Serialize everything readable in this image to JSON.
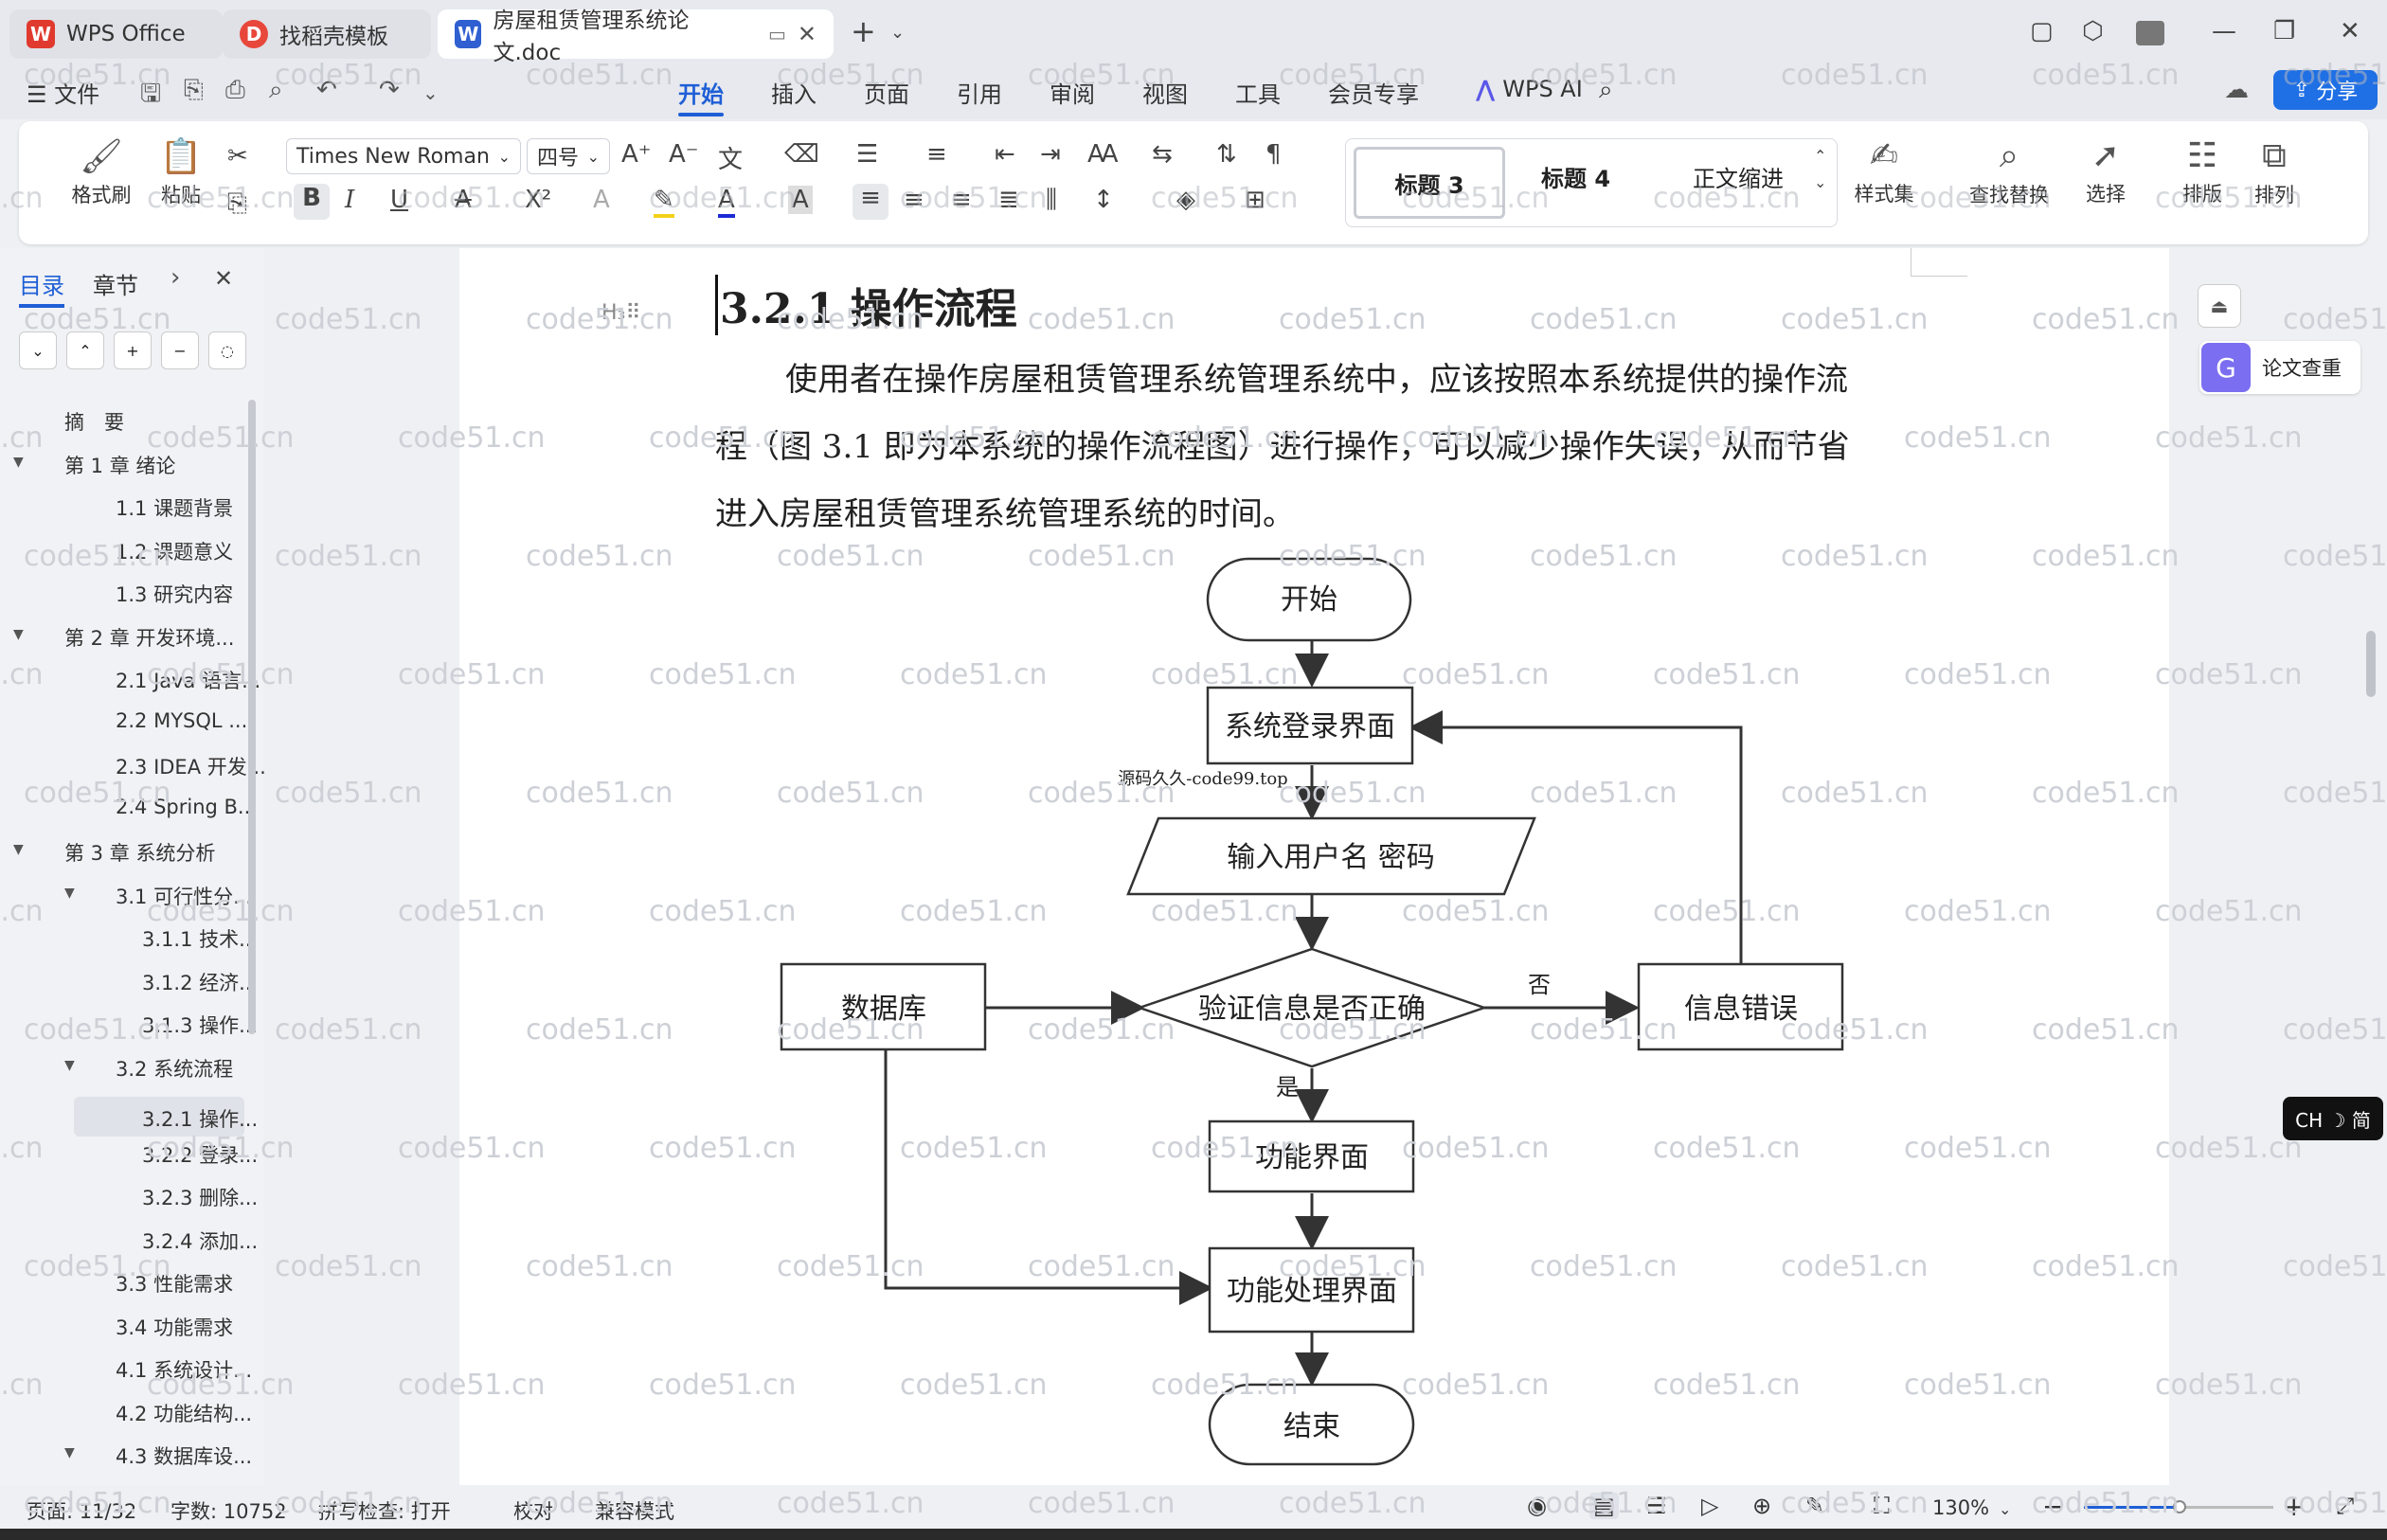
{
  "tabs": [
    {
      "label": "WPS Office"
    },
    {
      "label": "找稻壳模板"
    },
    {
      "label": "房屋租赁管理系统论文.doc"
    }
  ],
  "menu": {
    "file": "文件",
    "items": [
      "开始",
      "插入",
      "页面",
      "引用",
      "审阅",
      "视图",
      "工具",
      "会员专享"
    ],
    "active": "开始",
    "wps_ai": "WPS AI",
    "share": "分享"
  },
  "ribbon": {
    "format_painter": "格式刷",
    "paste": "粘贴",
    "font": "Times New Roman",
    "size": "四号",
    "styles": [
      "标题 3",
      "标题 4",
      "正文缩进"
    ],
    "style_set": "样式集",
    "find_replace": "查找替换",
    "select": "选择",
    "typeset": "排版",
    "arrange": "排列"
  },
  "nav": {
    "tab_toc": "目录",
    "tab_chapter": "章节",
    "items": [
      {
        "label": "摘　要",
        "level": 0
      },
      {
        "label": "第 1 章  绪论",
        "level": 0,
        "toggle": true
      },
      {
        "label": "1.1  课题背景",
        "level": 1
      },
      {
        "label": "1.2  课题意义",
        "level": 1
      },
      {
        "label": "1.3  研究内容",
        "level": 1
      },
      {
        "label": "第 2 章  开发环境...",
        "level": 0,
        "toggle": true
      },
      {
        "label": "2.1 Java 语言...",
        "level": 1
      },
      {
        "label": "2.2 MYSQL ...",
        "level": 1
      },
      {
        "label": "2.3 IDEA 开发...",
        "level": 1
      },
      {
        "label": "2.4 Spring B...",
        "level": 1
      },
      {
        "label": "第 3 章  系统分析",
        "level": 0,
        "toggle": true
      },
      {
        "label": "3.1  可行性分...",
        "level": 1,
        "toggle": true
      },
      {
        "label": "3.1.1  技术...",
        "level": 2
      },
      {
        "label": "3.1.2  经济...",
        "level": 2
      },
      {
        "label": "3.1.3  操作...",
        "level": 2
      },
      {
        "label": "3.2  系统流程",
        "level": 1,
        "toggle": true
      },
      {
        "label": "3.2.1  操作...",
        "level": 2,
        "active": true
      },
      {
        "label": "3.2.2  登录...",
        "level": 2
      },
      {
        "label": "3.2.3  删除...",
        "level": 2
      },
      {
        "label": "3.2.4  添加...",
        "level": 2
      },
      {
        "label": "3.3  性能需求",
        "level": 1
      },
      {
        "label": "3.4  功能需求",
        "level": 1
      },
      {
        "label": "4.1  系统设计...",
        "level": 1
      },
      {
        "label": "4.2  功能结构...",
        "level": 1
      },
      {
        "label": "4.3  数据库设...",
        "level": 1,
        "toggle": true
      }
    ]
  },
  "document": {
    "heading": "3.2.1  操作流程",
    "paragraph_lines": [
      "使用者在操作房屋租赁管理系统管理系统中，应该按照本系统提供的操作流",
      "程（图 3.1 即为本系统的操作流程图）进行操作，可以减少操作失误，从而节省",
      "进入房屋租赁管理系统管理系统的时间。"
    ],
    "flow": {
      "start": "开始",
      "login": "系统登录界面",
      "input": "输入用户名 密码",
      "verify": "验证信息是否正确",
      "db": "数据库",
      "error": "信息错误",
      "func": "功能界面",
      "process": "功能处理界面",
      "end": "结束",
      "no": "否",
      "yes": "是",
      "source_note": "源码久久-code99.top"
    }
  },
  "right_panel": {
    "plagiarism": "论文查重",
    "ime": "CH ☽ 简"
  },
  "status": {
    "page": "页面: 11/32",
    "words": "字数: 10752",
    "spell": "拼写检查: 打开",
    "proof": "校对",
    "compat": "兼容模式",
    "zoom": "130%"
  },
  "watermark": "code51.cn",
  "colors": {
    "accent": "#1f5fd6",
    "wps_red": "#e03a2f",
    "doc_blue": "#2f5fd0"
  }
}
